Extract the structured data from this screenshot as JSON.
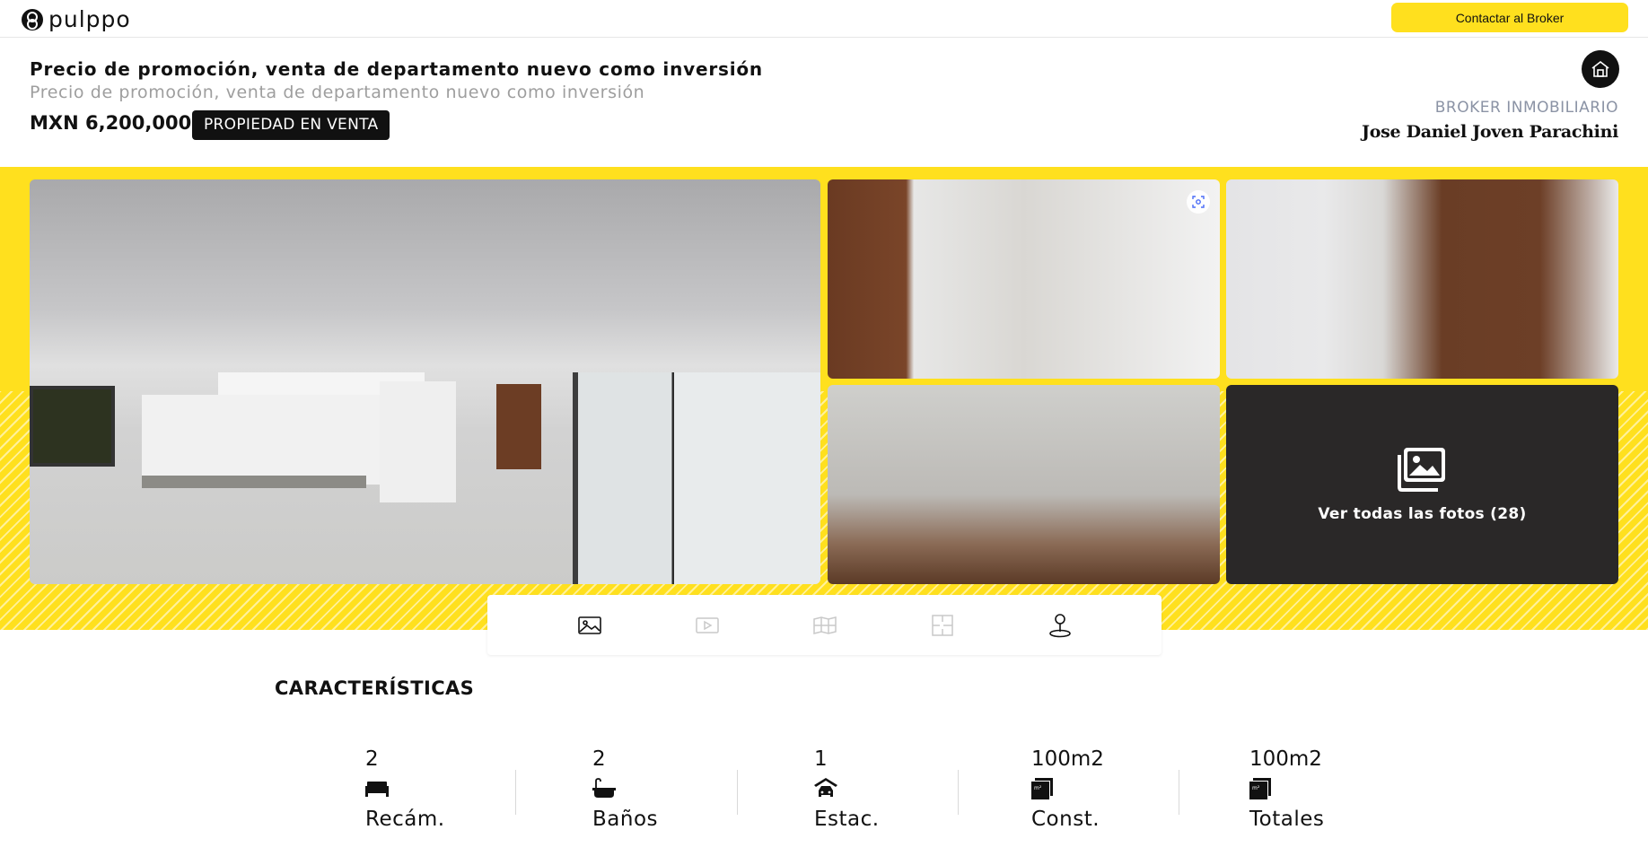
{
  "nav": {
    "brand": "pulppo",
    "contact_button": "Contactar al Broker"
  },
  "listing": {
    "title": "Precio de promoción, venta de departamento nuevo como inversión",
    "subtitle": "Precio de promoción, venta de departamento nuevo como inversión",
    "price": "MXN 6,200,000",
    "status": "PROPIEDAD EN VENTA"
  },
  "broker": {
    "label": "BROKER INMOBILIARIO",
    "name": "Jose Daniel Joven Parachini"
  },
  "gallery": {
    "all_photos_label": "Ver todas las fotos (28)",
    "photos": [
      "kitchen-living-room",
      "kitchen-view",
      "bedroom-closet",
      "bathroom",
      "more-photos"
    ]
  },
  "media_tabs": [
    {
      "icon": "image-icon",
      "active": true
    },
    {
      "icon": "video-icon",
      "active": false
    },
    {
      "icon": "map-icon",
      "active": false
    },
    {
      "icon": "floorplan-icon",
      "active": false
    },
    {
      "icon": "location-pin-icon",
      "active": true
    }
  ],
  "characteristics": {
    "title": "CARACTERÍSTICAS",
    "items": [
      {
        "value": "2",
        "label": "Recám.",
        "icon": "bed-icon"
      },
      {
        "value": "2",
        "label": "Baños",
        "icon": "bathtub-icon"
      },
      {
        "value": "1",
        "label": "Estac.",
        "icon": "car-parking-icon"
      },
      {
        "value": "100m2",
        "label": "Const.",
        "icon": "area-icon"
      },
      {
        "value": "100m2",
        "label": "Totales",
        "icon": "area-icon"
      }
    ]
  },
  "colors": {
    "brand_yellow": "#ffe01e",
    "text_dark": "#111111",
    "muted_gray": "#9e9e9e",
    "broker_label": "#8b93a5"
  }
}
